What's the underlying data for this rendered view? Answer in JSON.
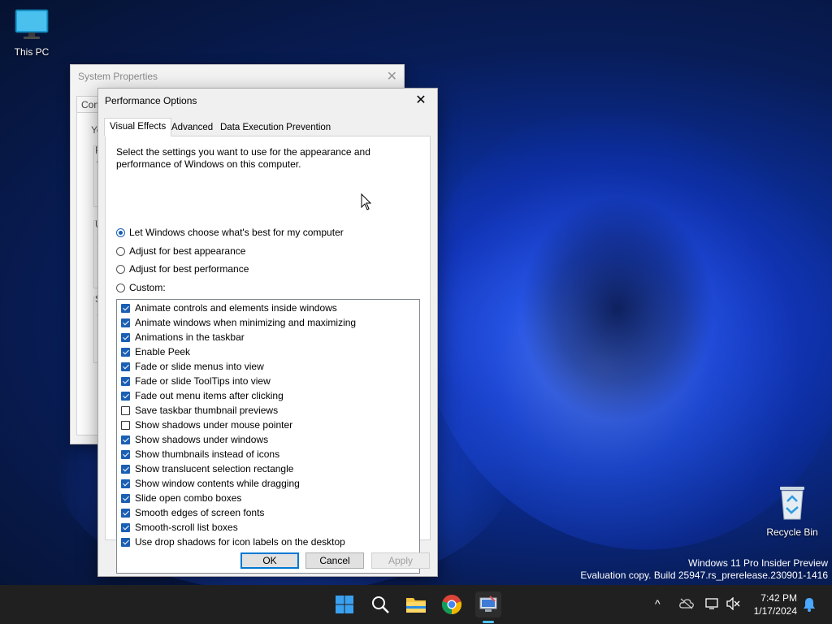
{
  "desktop": {
    "icons": [
      {
        "label": "This PC"
      },
      {
        "label": "Recycle Bin"
      }
    ],
    "watermark": {
      "line1": "Windows 11 Pro Insider Preview",
      "line2": "Evaluation copy. Build 25947.rs_prerelease.230901-1416"
    }
  },
  "system_properties": {
    "title": "System Properties",
    "tab_fragment": "Com",
    "text_fragments": [
      "Yo",
      "P",
      "V",
      "U",
      "D",
      "S",
      "S"
    ]
  },
  "performance_options": {
    "title": "Performance Options",
    "tabs": [
      {
        "label": "Visual Effects",
        "active": true
      },
      {
        "label": "Advanced",
        "active": false
      },
      {
        "label": "Data Execution Prevention",
        "active": false
      }
    ],
    "description": "Select the settings you want to use for the appearance and performance of Windows on this computer.",
    "radios": [
      {
        "label": "Let Windows choose what's best for my computer",
        "selected": true
      },
      {
        "label": "Adjust for best appearance",
        "selected": false
      },
      {
        "label": "Adjust for best performance",
        "selected": false
      },
      {
        "label": "Custom:",
        "selected": false
      }
    ],
    "effects": [
      {
        "label": "Animate controls and elements inside windows",
        "checked": true
      },
      {
        "label": "Animate windows when minimizing and maximizing",
        "checked": true
      },
      {
        "label": "Animations in the taskbar",
        "checked": true
      },
      {
        "label": "Enable Peek",
        "checked": true
      },
      {
        "label": "Fade or slide menus into view",
        "checked": true
      },
      {
        "label": "Fade or slide ToolTips into view",
        "checked": true
      },
      {
        "label": "Fade out menu items after clicking",
        "checked": true
      },
      {
        "label": "Save taskbar thumbnail previews",
        "checked": false
      },
      {
        "label": "Show shadows under mouse pointer",
        "checked": false
      },
      {
        "label": "Show shadows under windows",
        "checked": true
      },
      {
        "label": "Show thumbnails instead of icons",
        "checked": true
      },
      {
        "label": "Show translucent selection rectangle",
        "checked": true
      },
      {
        "label": "Show window contents while dragging",
        "checked": true
      },
      {
        "label": "Slide open combo boxes",
        "checked": true
      },
      {
        "label": "Smooth edges of screen fonts",
        "checked": true
      },
      {
        "label": "Smooth-scroll list boxes",
        "checked": true
      },
      {
        "label": "Use drop shadows for icon labels on the desktop",
        "checked": true
      }
    ],
    "buttons": {
      "ok": "OK",
      "cancel": "Cancel",
      "apply": "Apply"
    }
  },
  "taskbar": {
    "apps": [
      "start-icon",
      "search-icon",
      "file-explorer-icon",
      "chrome-icon",
      "system-properties-icon"
    ],
    "tray": [
      "chevron-up-icon",
      "onedrive-icon",
      "network-icon",
      "volume-muted-icon",
      "notification-bell-icon"
    ],
    "time": "7:42 PM",
    "date": "1/17/2024"
  },
  "colors": {
    "accent": "#1a5fb4",
    "taskbar": "#202020",
    "dialog_bg": "#f0f0f0"
  }
}
